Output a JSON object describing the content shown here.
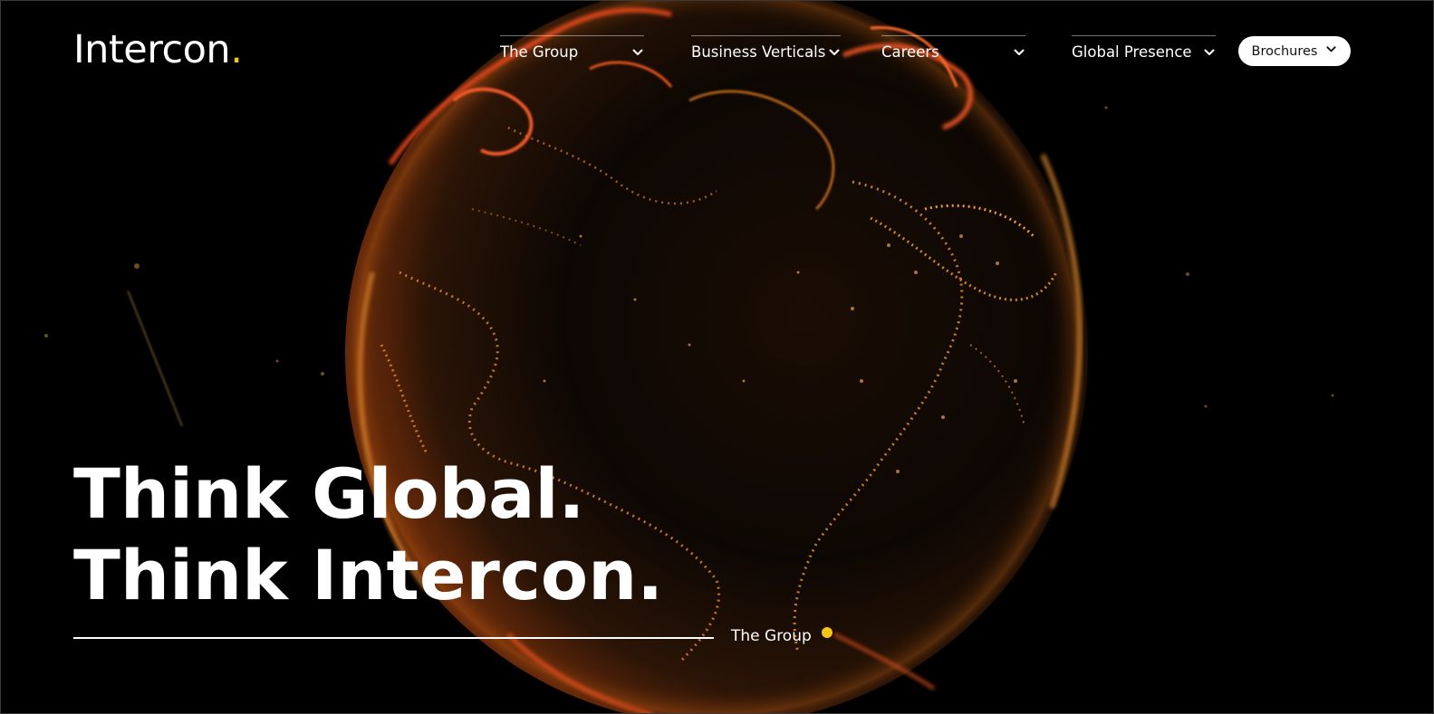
{
  "brand": {
    "name": "Intercon",
    "dot": ".",
    "accent_color": "#f5c518"
  },
  "nav": {
    "items": [
      {
        "label": "The Group",
        "icon": "chevron-down-icon"
      },
      {
        "label": "Business Verticals",
        "icon": "chevron-down-icon"
      },
      {
        "label": "Careers",
        "icon": "chevron-down-icon"
      },
      {
        "label": "Global Presence",
        "icon": "chevron-down-icon"
      }
    ],
    "brochures": {
      "label": "Brochures",
      "icon": "chevron-down-icon"
    }
  },
  "hero": {
    "line1": "Think Global.",
    "line2": "Think Intercon.",
    "link_label": "The Group",
    "background": "night-earth-globe-image"
  },
  "colors": {
    "background": "#000000",
    "text": "#ffffff",
    "accent": "#f5c518"
  }
}
